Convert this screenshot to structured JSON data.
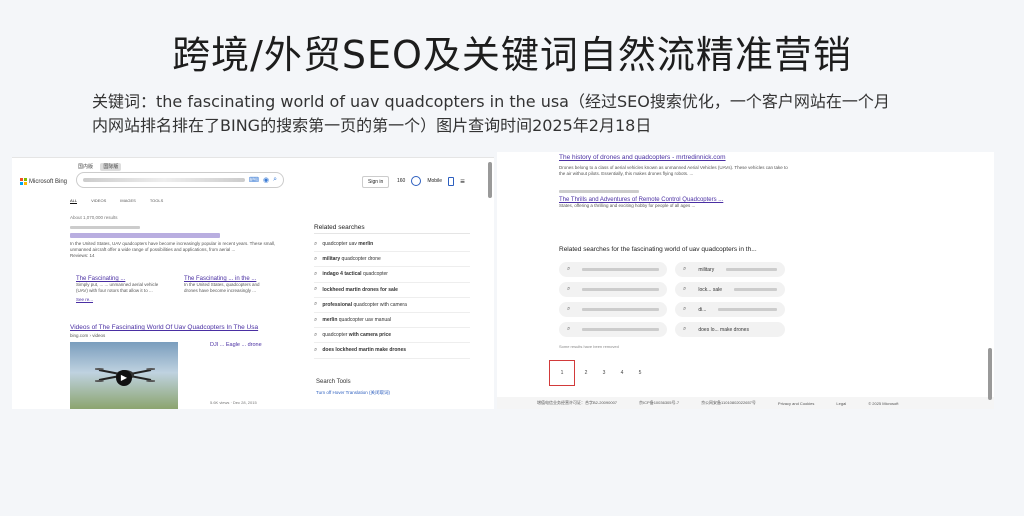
{
  "slide": {
    "title": "跨境/外贸SEO及关键词自然流精准营销",
    "subtitle": "关键词：the fascinating world of uav quadcopters in the usa（经过SEO搜索优化，一个客户网站在一个月内网站排名排在了BING的搜索第一页的第一个）图片查询时间2025年2月18日"
  },
  "bing_left": {
    "top_tabs": [
      "国内版",
      "国际版"
    ],
    "logo_text": "Microsoft Bing",
    "signin": "Sign in",
    "points": "160",
    "mobile": "Mobile",
    "tabs": [
      "ALL",
      "VIDEOS",
      "IMAGES",
      "TOOLS"
    ],
    "results_count": "About 1,070,000 results",
    "result1_snippet": "In the United States, UAV quadcopters have become increasingly popular in recent years. These small, unmanned aircraft offer a wide range of possibilities and applications, from aerial ...",
    "reviews_label": "Reviews: 14",
    "sub1_title": "The Fascinating ...",
    "sub1_snippet": "Simply put, ... ... unmanned aerial vehicle (UAV) with four rotors that allow it to ...",
    "sub2_title": "The Fascinating ... in the ...",
    "sub2_snippet": "In the United States, quadcopters and drones have become increasingly ...",
    "see_more": "See re...",
    "videos_title": "Videos of The Fascinating World Of Uav Quadcopters In The Usa",
    "videos_source": "bing.com › videos",
    "video2_title": "DJI ... Eagle ... drone",
    "video_meta": "5.6K views · Dec 28, 2015",
    "related_title": "Related searches",
    "related": [
      {
        "pre": "quadcopter uav ",
        "bold": "merlin"
      },
      {
        "pre": "",
        "bold": "military",
        "post": " quadcopter drone"
      },
      {
        "pre": "",
        "bold": "indago 4 tactical",
        "post": " quadcopter"
      },
      {
        "pre": "",
        "bold": "lockheed martin drones for sale",
        "post": ""
      },
      {
        "pre": "",
        "bold": "professional",
        "post": " quadcopter with camera"
      },
      {
        "pre": "",
        "bold": "merlin",
        "post": " quadcopter uav manual"
      },
      {
        "pre": "quadcopter ",
        "bold": "with camera price",
        "post": ""
      },
      {
        "pre": "",
        "bold": "does lockheed martin make drones",
        "post": ""
      }
    ],
    "search_tools": "Search Tools",
    "hover_translation": "Turn off Hover Translation (关闭取词)"
  },
  "bing_right": {
    "result_title": "The history of drones and quadcopters - mrtredinnick.com",
    "result_snippet": "Drones belong to a class of aerial vehicles known as unmanned Aerial Vehicles (UAVs). These vehicles can take to the air without pilots. Essentially, this makes drones flying robots. ...",
    "result2_title": "The Thrills and Adventures of Remote Control Quadcopters ...",
    "result2_snippet": "States, offering a thrilling and exciting hobby for people of all ages ...",
    "related_heading": "Related searches for the fascinating world of uav quadcopters in th...",
    "pills": [
      "military",
      "lock... sale",
      "di...",
      "does lo... make drones"
    ],
    "removed_note": "Some results have been removed",
    "pages": [
      "1",
      "2",
      "3",
      "4",
      "5"
    ],
    "footer": [
      "增值电信业务经营许可证：合字B2-20090007",
      "京ICP备10036305号-7",
      "京公网安备11010802022657号",
      "Privacy and Cookies",
      "Legal",
      "© 2025 Microsoft"
    ]
  }
}
